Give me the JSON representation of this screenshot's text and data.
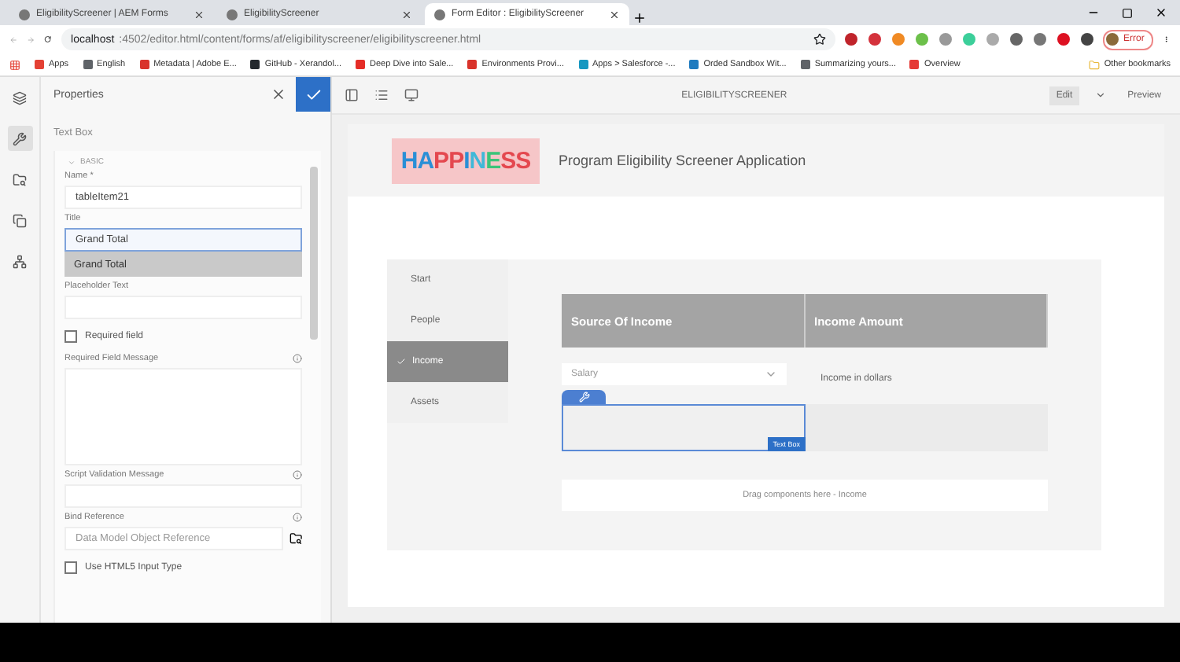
{
  "browser": {
    "tabs": [
      {
        "title": "EligibilityScreener | AEM Forms",
        "selected": false
      },
      {
        "title": "EligibilityScreener",
        "selected": false
      },
      {
        "title": "Form Editor : EligibilityScreener",
        "selected": true
      }
    ],
    "url_host": "localhost",
    "url_rest": ":4502/editor.html/content/forms/af/eligibilityscreener/eligibilityscreener.html",
    "profile": "Error",
    "bookmarks": [
      {
        "label": "Apps",
        "color": "#e44134"
      },
      {
        "label": "English",
        "color": "#5f6368"
      },
      {
        "label": "Metadata | Adobe E...",
        "color": "#d9332b"
      },
      {
        "label": "GitHub - Xerandol...",
        "color": "#24292e"
      },
      {
        "label": "Deep Dive into Sale...",
        "color": "#e52d27"
      },
      {
        "label": "Environments Provi...",
        "color": "#d9332b"
      },
      {
        "label": "Apps > Salesforce -...",
        "color": "#1798c1"
      },
      {
        "label": "Orded Sandbox Wit...",
        "color": "#1f7bbf"
      },
      {
        "label": "Summarizing yours...",
        "color": "#5f6368"
      },
      {
        "label": "Overview",
        "color": "#e53935"
      }
    ],
    "other_bookmarks": "Other bookmarks"
  },
  "properties": {
    "title": "Properties",
    "component": "Text Box",
    "section": "BASIC",
    "name_label": "Name *",
    "name_value": "tableItem21",
    "title_label": "Title",
    "title_value": "Grand Total",
    "suggestion": "Grand Total",
    "placeholder_label": "Placeholder Text",
    "required_label": "Required field",
    "required_checked": false,
    "required_message_label": "Required Field Message",
    "script_message_label": "Script Validation Message",
    "bind_label": "Bind Reference",
    "bind_placeholder": "Data Model Object Reference",
    "html5_label": "Use HTML5 Input Type",
    "html5_checked": false
  },
  "editor": {
    "title": "ELIGIBILITYSCREENER",
    "mode": "Edit",
    "preview": "Preview",
    "logo": "HAPPINESS",
    "heading": "Program Eligibility Screener Application",
    "steps": [
      {
        "label": "Start",
        "selected": false
      },
      {
        "label": "People",
        "selected": false
      },
      {
        "label": "Income",
        "selected": true
      },
      {
        "label": "Assets",
        "selected": false
      }
    ],
    "columns": [
      "Source Of Income",
      "Income Amount"
    ],
    "dropdown_value": "Salary",
    "amount_text": "Income in dollars",
    "badge": "Text Box",
    "dropzone": "Drag components here - Income"
  }
}
